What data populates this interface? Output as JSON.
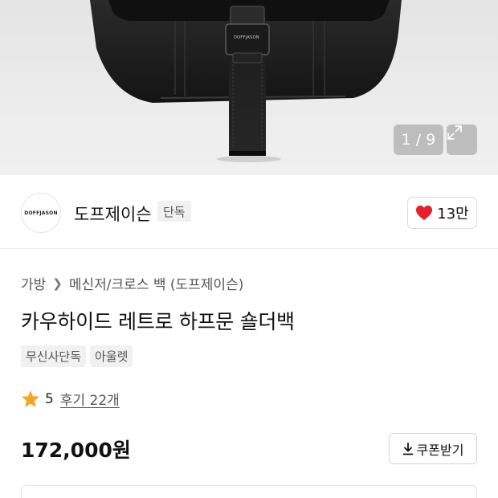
{
  "gallery": {
    "counter": "1 / 9",
    "image_brand_text": "DOFFJASON",
    "icons": {
      "expand": "expand-arrows-icon"
    }
  },
  "brand": {
    "logo_text": "DOFFJASON",
    "name": "도프제이슨",
    "exclusive_tag": "단독",
    "like_count": "13만",
    "icons": {
      "like": "heart-icon"
    },
    "like_color": "#e8202a"
  },
  "product": {
    "breadcrumb": [
      "가방",
      "메신저/크로스 백 (도프제이슨)"
    ],
    "title": "카우하이드 레트로 하프문 숄더백",
    "tags": [
      "무신사단독",
      "아울렛"
    ],
    "rating": "5",
    "reviews": "후기 22개",
    "rating_color": "#f5a623",
    "price": "172,000원",
    "coupon_label": "쿠폰받기",
    "icons": {
      "star": "star-icon",
      "coupon": "download-icon"
    }
  }
}
